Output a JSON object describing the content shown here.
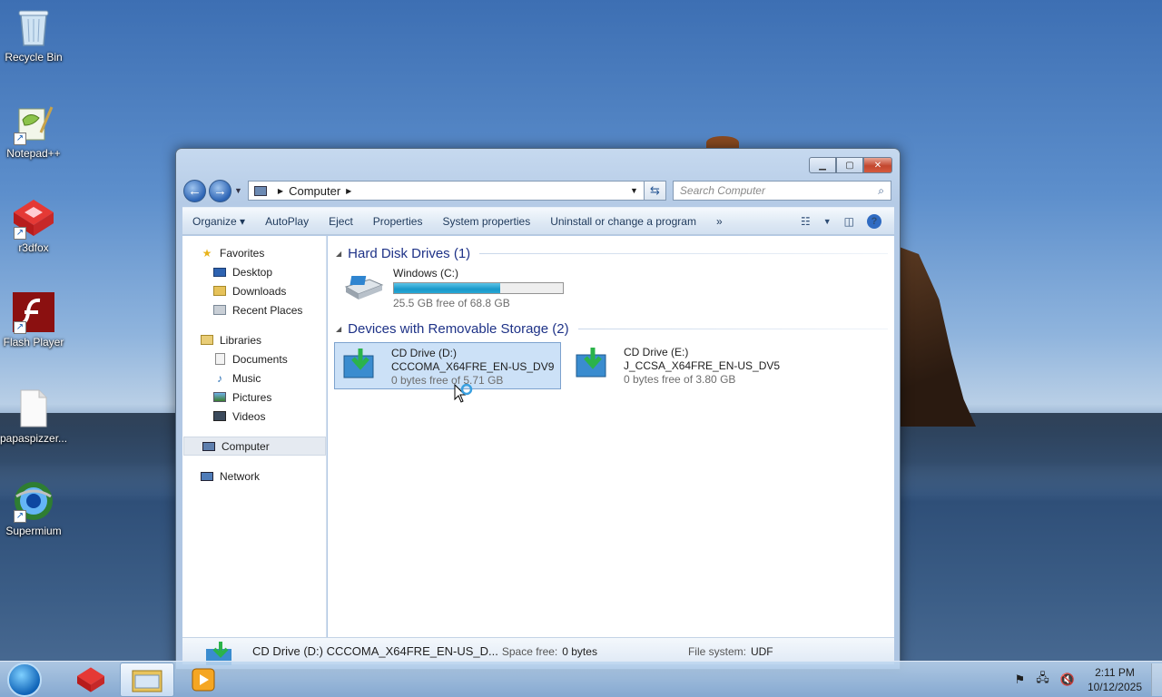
{
  "desktop": {
    "icons": [
      {
        "label": "Recycle Bin",
        "icon": "recycle-bin-icon"
      },
      {
        "label": "Notepad++",
        "icon": "notepad-plus-plus-icon"
      },
      {
        "label": "r3dfox",
        "icon": "r3dfox-icon"
      },
      {
        "label": "Flash Player",
        "icon": "flash-player-icon"
      },
      {
        "label": "papaspizzer...",
        "icon": "file-icon"
      },
      {
        "label": "Supermium",
        "icon": "supermium-icon"
      }
    ]
  },
  "window": {
    "address": {
      "segments": [
        "Computer"
      ]
    },
    "search": {
      "placeholder": "Search Computer"
    },
    "toolbar": {
      "organize": "Organize",
      "autoplay": "AutoPlay",
      "eject": "Eject",
      "properties": "Properties",
      "system_properties": "System properties",
      "uninstall": "Uninstall or change a program",
      "more": "»"
    },
    "nav": {
      "favorites": "Favorites",
      "desktop": "Desktop",
      "downloads": "Downloads",
      "recent_places": "Recent Places",
      "libraries": "Libraries",
      "documents": "Documents",
      "music": "Music",
      "pictures": "Pictures",
      "videos": "Videos",
      "computer": "Computer",
      "network": "Network"
    },
    "groups": {
      "hard_disk": "Hard Disk Drives (1)",
      "removable": "Devices with Removable Storage (2)"
    },
    "drives": {
      "c": {
        "name": "Windows (C:)",
        "free": "25.5 GB free of 68.8 GB",
        "used_fraction": 0.63
      },
      "d": {
        "name": "CD Drive (D:)",
        "label": "CCCOMA_X64FRE_EN-US_DV9",
        "free": "0 bytes free of 5.71 GB"
      },
      "e": {
        "name": "CD Drive (E:)",
        "label": "J_CCSA_X64FRE_EN-US_DV5",
        "free": "0 bytes free of 3.80 GB"
      }
    },
    "details": {
      "title": "CD Drive (D:) CCCOMA_X64FRE_EN-US_D...",
      "space_free_label": "Space free:",
      "space_free_value": "0 bytes",
      "file_system_label": "File system:",
      "file_system_value": "UDF"
    }
  },
  "taskbar": {
    "time": "2:11 PM",
    "date": "10/12/2025"
  },
  "colors": {
    "accent": "#1e3287",
    "selection": "#cce1f7",
    "bar_fill": "#1a98c9"
  }
}
